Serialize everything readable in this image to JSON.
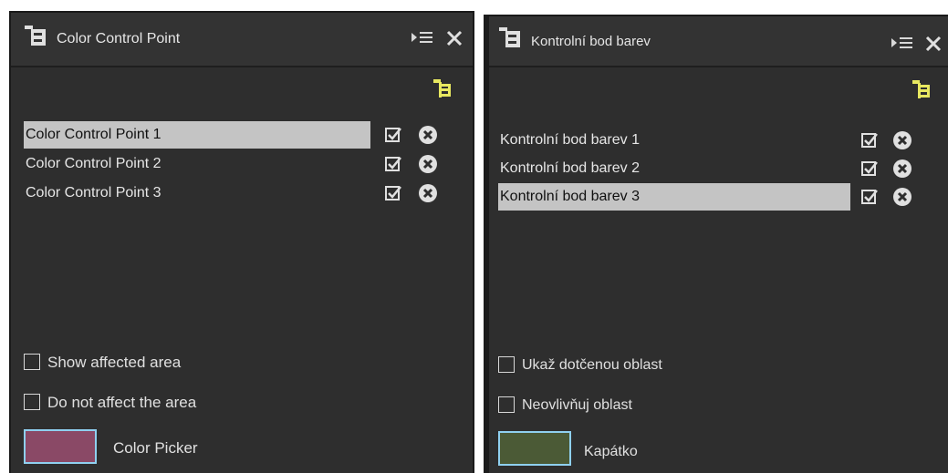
{
  "left_panel": {
    "title": "Color Control Point",
    "points": [
      {
        "label": "Color Control Point 1",
        "selected": true,
        "enabled": true
      },
      {
        "label": "Color Control Point 2",
        "selected": false,
        "enabled": true
      },
      {
        "label": "Color Control Point 3",
        "selected": false,
        "enabled": true
      }
    ],
    "show_affected_area": {
      "label": "Show affected area",
      "checked": false
    },
    "do_not_affect": {
      "label": "Do not affect the area",
      "checked": false
    },
    "color_picker": {
      "label": "Color Picker",
      "color": "#8a4966"
    }
  },
  "right_panel": {
    "title": "Kontrolní bod barev",
    "points": [
      {
        "label": "Kontrolní bod barev 1",
        "selected": false,
        "enabled": true
      },
      {
        "label": "Kontrolní bod barev 2",
        "selected": false,
        "enabled": true
      },
      {
        "label": "Kontrolní bod barev 3",
        "selected": true,
        "enabled": true
      }
    ],
    "show_affected_area": {
      "label": "Ukaž dotčenou oblast",
      "checked": false
    },
    "do_not_affect": {
      "label": "Neovlivňuj oblast",
      "checked": false
    },
    "color_picker": {
      "label": "Kapátko",
      "color": "#4b5a36"
    }
  },
  "icons": {
    "panel_icon": "tree-panel-icon",
    "menu": "panel-menu-icon",
    "close": "close-icon",
    "add_point": "add-control-point-icon",
    "enable": "checkbox-checked-icon",
    "delete": "delete-circle-icon"
  },
  "colors": {
    "panel_bg": "#2e2e2e",
    "selection": "#c4c4c4",
    "add_icon": "#e8e860",
    "swatch_border": "#8fd0f0"
  }
}
